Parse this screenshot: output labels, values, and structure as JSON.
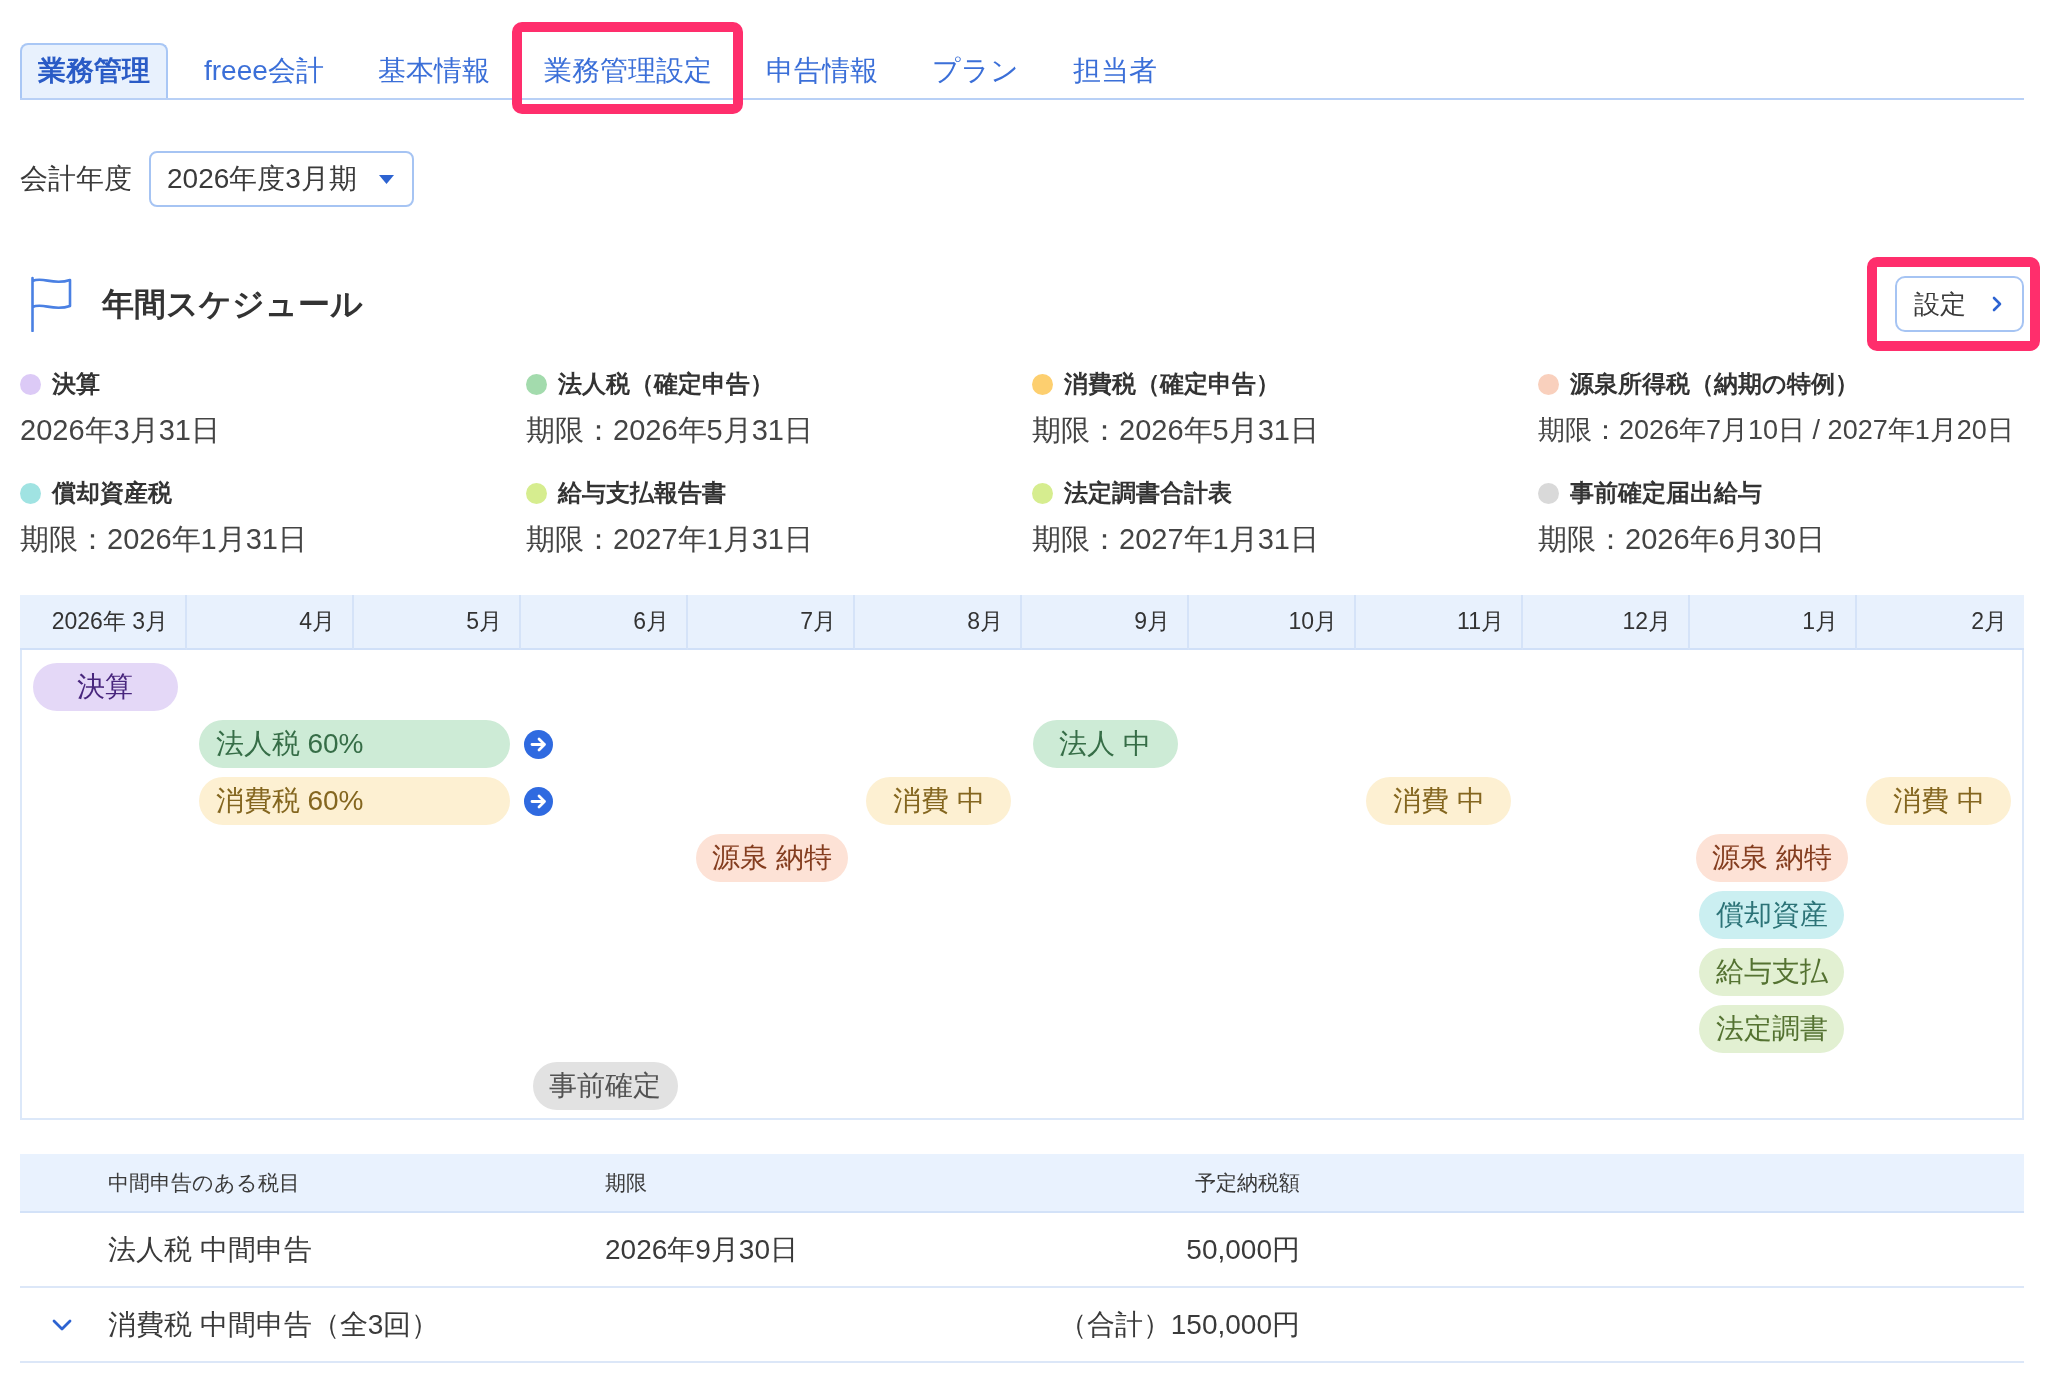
{
  "tabs": [
    {
      "label": "業務管理",
      "selected": true,
      "highlighted": false
    },
    {
      "label": "freee会計",
      "selected": false,
      "highlighted": false
    },
    {
      "label": "基本情報",
      "selected": false,
      "highlighted": false
    },
    {
      "label": "業務管理設定",
      "selected": false,
      "highlighted": true
    },
    {
      "label": "申告情報",
      "selected": false,
      "highlighted": false
    },
    {
      "label": "プラン",
      "selected": false,
      "highlighted": false
    },
    {
      "label": "担当者",
      "selected": false,
      "highlighted": false
    }
  ],
  "fiscal_year": {
    "label": "会計年度",
    "value": "2026年度3月期"
  },
  "schedule": {
    "title": "年間スケジュール",
    "settings_button": {
      "label": "設定",
      "highlighted": true
    },
    "legend": [
      {
        "name": "決算",
        "deadline": "2026年3月31日",
        "color": "#dccaf6"
      },
      {
        "name": "法人税（確定申告）",
        "deadline": "期限：2026年5月31日",
        "color": "#a3dbad"
      },
      {
        "name": "消費税（確定申告）",
        "deadline": "期限：2026年5月31日",
        "color": "#fdcf6f"
      },
      {
        "name": "源泉所得税（納期の特例）",
        "deadline": "期限：2026年7月10日 / 2027年1月20日",
        "color": "#f9d0bd"
      },
      {
        "name": "償却資産税",
        "deadline": "期限：2026年1月31日",
        "color": "#a0e3e2"
      },
      {
        "name": "給与支払報告書",
        "deadline": "期限：2027年1月31日",
        "color": "#d6ed8f"
      },
      {
        "name": "法定調書合計表",
        "deadline": "期限：2027年1月31日",
        "color": "#d6ed8f"
      },
      {
        "name": "事前確定届出給与",
        "deadline": "期限：2026年6月30日",
        "color": "#d9d9d9"
      }
    ],
    "timeline": {
      "months": [
        "2026年 3月",
        "4月",
        "5月",
        "6月",
        "7月",
        "8月",
        "9月",
        "10月",
        "11月",
        "12月",
        "1月",
        "2月"
      ],
      "lanes": [
        {
          "slots": [
            {
              "kind": "chip",
              "label": "決算",
              "color": "#e4d8f7"
            },
            {
              "kind": "empty"
            },
            {
              "kind": "empty"
            },
            {
              "kind": "empty"
            },
            {
              "kind": "empty"
            },
            {
              "kind": "empty"
            },
            {
              "kind": "empty"
            },
            {
              "kind": "empty"
            },
            {
              "kind": "empty"
            },
            {
              "kind": "empty"
            },
            {
              "kind": "empty"
            },
            {
              "kind": "empty"
            }
          ]
        },
        {
          "slots": [
            {
              "kind": "empty"
            },
            {
              "kind": "bar",
              "label": "法人税 60%",
              "color": "#cdebd6"
            },
            {
              "kind": "arrow"
            },
            {
              "kind": "empty"
            },
            {
              "kind": "empty"
            },
            {
              "kind": "chip",
              "label": "法人 中",
              "color": "#cdebd6"
            },
            {
              "kind": "empty"
            },
            {
              "kind": "empty"
            },
            {
              "kind": "empty"
            },
            {
              "kind": "empty"
            },
            {
              "kind": "empty"
            }
          ]
        },
        {
          "slots": [
            {
              "kind": "empty"
            },
            {
              "kind": "bar",
              "label": "消費税 60%",
              "color": "#fdf0d2"
            },
            {
              "kind": "arrow"
            },
            {
              "kind": "empty"
            },
            {
              "kind": "chip",
              "label": "消費 中",
              "color": "#fdf0d2"
            },
            {
              "kind": "empty"
            },
            {
              "kind": "empty"
            },
            {
              "kind": "chip",
              "label": "消費 中",
              "color": "#fdf0d2"
            },
            {
              "kind": "empty"
            },
            {
              "kind": "empty"
            },
            {
              "kind": "chip",
              "label": "消費 中",
              "color": "#fdf0d2"
            }
          ]
        },
        {
          "slots": [
            {
              "kind": "empty"
            },
            {
              "kind": "empty"
            },
            {
              "kind": "empty"
            },
            {
              "kind": "empty"
            },
            {
              "kind": "chip",
              "label": "源泉 納特",
              "color": "#fde2d6"
            },
            {
              "kind": "empty"
            },
            {
              "kind": "empty"
            },
            {
              "kind": "empty"
            },
            {
              "kind": "empty"
            },
            {
              "kind": "empty"
            },
            {
              "kind": "chip",
              "label": "源泉 納特",
              "color": "#fde2d6"
            },
            {
              "kind": "empty"
            }
          ]
        },
        {
          "slots": [
            {
              "kind": "empty"
            },
            {
              "kind": "empty"
            },
            {
              "kind": "empty"
            },
            {
              "kind": "empty"
            },
            {
              "kind": "empty"
            },
            {
              "kind": "empty"
            },
            {
              "kind": "empty"
            },
            {
              "kind": "empty"
            },
            {
              "kind": "empty"
            },
            {
              "kind": "empty"
            },
            {
              "kind": "chip",
              "label": "償却資産",
              "color": "#cbeff1"
            },
            {
              "kind": "empty"
            }
          ]
        },
        {
          "slots": [
            {
              "kind": "empty"
            },
            {
              "kind": "empty"
            },
            {
              "kind": "empty"
            },
            {
              "kind": "empty"
            },
            {
              "kind": "empty"
            },
            {
              "kind": "empty"
            },
            {
              "kind": "empty"
            },
            {
              "kind": "empty"
            },
            {
              "kind": "empty"
            },
            {
              "kind": "empty"
            },
            {
              "kind": "chip",
              "label": "給与支払",
              "color": "#e2f0d2"
            },
            {
              "kind": "empty"
            }
          ]
        },
        {
          "slots": [
            {
              "kind": "empty"
            },
            {
              "kind": "empty"
            },
            {
              "kind": "empty"
            },
            {
              "kind": "empty"
            },
            {
              "kind": "empty"
            },
            {
              "kind": "empty"
            },
            {
              "kind": "empty"
            },
            {
              "kind": "empty"
            },
            {
              "kind": "empty"
            },
            {
              "kind": "empty"
            },
            {
              "kind": "chip",
              "label": "法定調書",
              "color": "#e2f0d2"
            },
            {
              "kind": "empty"
            }
          ]
        },
        {
          "slots": [
            {
              "kind": "empty"
            },
            {
              "kind": "empty"
            },
            {
              "kind": "empty"
            },
            {
              "kind": "chip",
              "label": "事前確定",
              "color": "#e2e2e2"
            },
            {
              "kind": "empty"
            },
            {
              "kind": "empty"
            },
            {
              "kind": "empty"
            },
            {
              "kind": "empty"
            },
            {
              "kind": "empty"
            },
            {
              "kind": "empty"
            },
            {
              "kind": "empty"
            },
            {
              "kind": "empty"
            }
          ]
        }
      ]
    }
  },
  "interim_table": {
    "columns": [
      "中間申告のある税目",
      "期限",
      "予定納税額"
    ],
    "rows": [
      {
        "kind": "single",
        "tax": "法人税 中間申告",
        "deadline": "2026年9月30日",
        "amount": "50,000円"
      },
      {
        "kind": "group",
        "expanded": false,
        "tax": "消費税 中間申告（全3回）",
        "amount": "（合計）150,000円"
      }
    ]
  }
}
